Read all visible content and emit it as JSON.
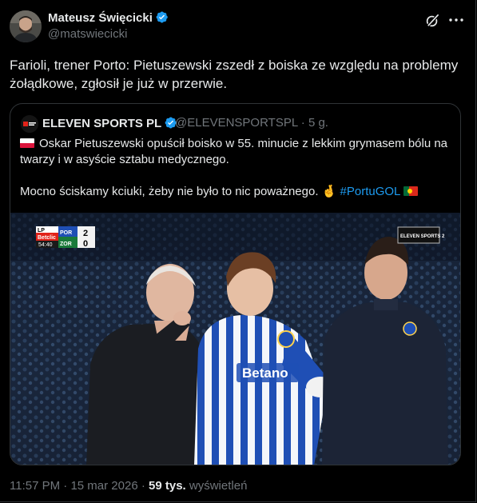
{
  "author": {
    "name": "Mateusz Święcicki",
    "handle": "@matswiecicki"
  },
  "tweet": {
    "text": "Farioli, trener Porto: Pietuszewski zszedł z boiska ze względu na problemy żołądkowe, zgłosił je już w przerwie."
  },
  "quote": {
    "name": "ELEVEN SPORTS PL",
    "handle_line": "@ELEVENSPORTSPL · 5 g.",
    "line1": "Oskar Pietuszewski opuścił boisko w 55. minucie z lekkim grymasem bólu na twarzy i w asyście sztabu medycznego.",
    "line2_prefix": "Mocno ściskamy kciuki, żeby nie było to nic poważnego. 🤞 ",
    "hashtag": "#PortuGOL"
  },
  "scoreboard": {
    "corner_logo": "LP",
    "sponsor": "Betclic",
    "clock": "54:40",
    "team1": "POR",
    "score1": "2",
    "team2": "ZOR",
    "score2": "0",
    "channel": "ELEVEN SPORTS 2"
  },
  "jersey_text": "Betano",
  "meta": {
    "time": "11:57 PM",
    "separator": " · ",
    "date": "15 mar 2026",
    "views": "59 tys.",
    "views_label": " wyświetleń"
  },
  "icons": {
    "verified": "verified-badge-icon",
    "grok": "grok-icon",
    "more": "more-options-icon"
  },
  "colors": {
    "background": "#000000",
    "text": "#e7e9ea",
    "muted": "#71767b",
    "accent": "#1d9bf0",
    "border": "#2f3336"
  }
}
